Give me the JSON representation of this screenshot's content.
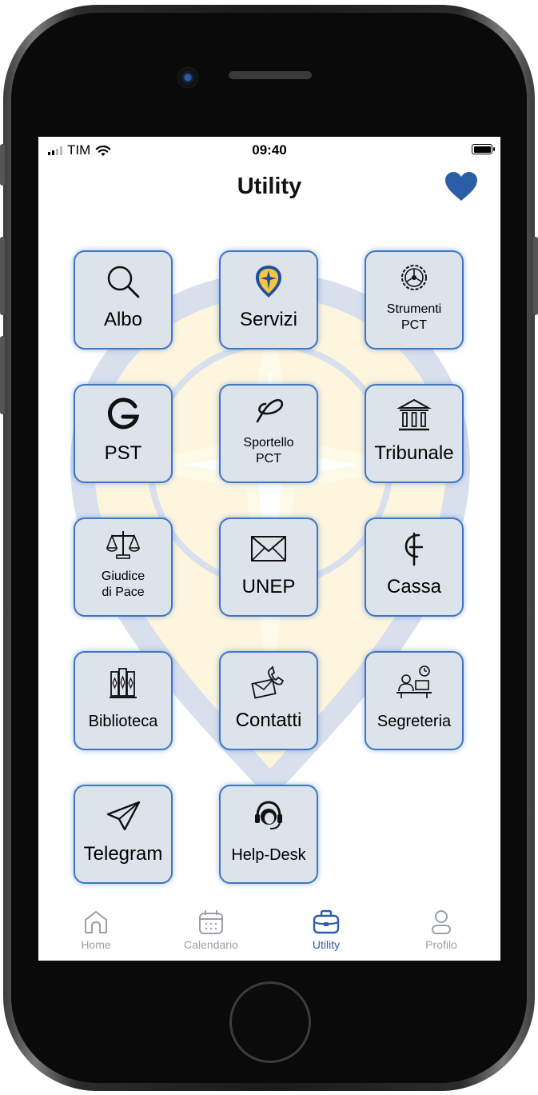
{
  "status_bar": {
    "carrier": "TIM",
    "time": "09:40",
    "signal_level": 2
  },
  "header": {
    "title": "Utility",
    "favorite_icon": "heart-icon",
    "accent": "#2b5ea7"
  },
  "tiles": [
    {
      "label": "Albo",
      "icon": "search-icon"
    },
    {
      "label": "Servizi",
      "icon": "compass-emblem-icon"
    },
    {
      "label": "Strumenti PCT",
      "line1": "Strumenti",
      "line2": "PCT",
      "icon": "gear-icon"
    },
    {
      "label": "PST",
      "icon": "g-logo-icon"
    },
    {
      "label": "Sportello PCT",
      "line1": "Sportello",
      "line2": "PCT",
      "icon": "loop-logo-icon"
    },
    {
      "label": "Tribunale",
      "icon": "courthouse-icon"
    },
    {
      "label": "Giudice di Pace",
      "line1": "Giudice",
      "line2": "di Pace",
      "icon": "scales-icon"
    },
    {
      "label": "UNEP",
      "icon": "envelope-icon"
    },
    {
      "label": "Cassa",
      "icon": "cassa-logo-icon"
    },
    {
      "label": "Biblioteca",
      "icon": "books-icon"
    },
    {
      "label": "Contatti",
      "icon": "phone-mail-icon"
    },
    {
      "label": "Segreteria",
      "icon": "office-desk-icon"
    },
    {
      "label": "Telegram",
      "icon": "paper-plane-icon"
    },
    {
      "label": "Help-Desk",
      "icon": "headset-icon"
    }
  ],
  "tabbar": {
    "items": [
      {
        "label": "Home",
        "icon": "home-icon"
      },
      {
        "label": "Calendario",
        "icon": "calendar-icon"
      },
      {
        "label": "Utility",
        "icon": "briefcase-icon",
        "active": true
      },
      {
        "label": "Profilo",
        "icon": "user-icon"
      }
    ]
  },
  "colors": {
    "tile_bg": "#dde3eb",
    "tile_border": "#3f77c4",
    "active_tab": "#2b5ea7",
    "inactive_tab": "#9aa0a6"
  }
}
